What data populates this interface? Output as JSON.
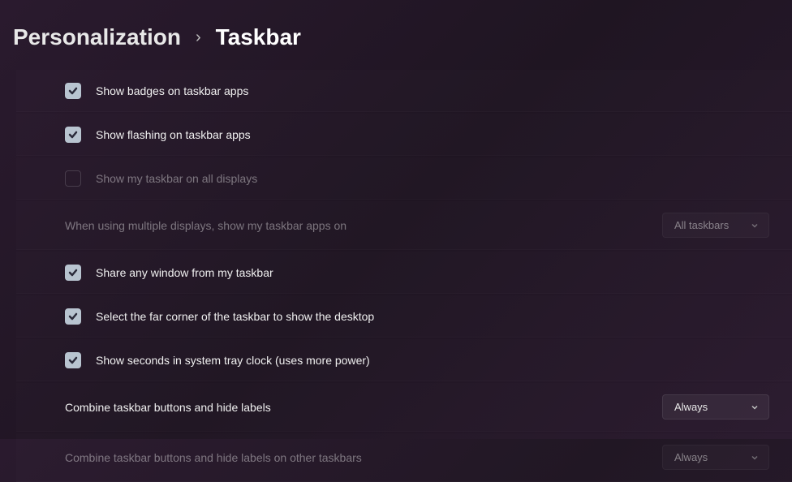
{
  "breadcrumb": {
    "parent": "Personalization",
    "current": "Taskbar"
  },
  "settings": {
    "show_badges": {
      "label": "Show badges on taskbar apps",
      "checked": true
    },
    "show_flashing": {
      "label": "Show flashing on taskbar apps",
      "checked": true
    },
    "show_all_displays": {
      "label": "Show my taskbar on all displays",
      "checked": false,
      "disabled": true
    },
    "multi_display_apps": {
      "label": "When using multiple displays, show my taskbar apps on",
      "value": "All taskbars",
      "disabled": true
    },
    "share_window": {
      "label": "Share any window from my taskbar",
      "checked": true
    },
    "far_corner": {
      "label": "Select the far corner of the taskbar to show the desktop",
      "checked": true
    },
    "show_seconds": {
      "label": "Show seconds in system tray clock (uses more power)",
      "checked": true
    },
    "combine_buttons": {
      "label": "Combine taskbar buttons and hide labels",
      "value": "Always"
    },
    "combine_buttons_other": {
      "label": "Combine taskbar buttons and hide labels on other taskbars",
      "value": "Always",
      "disabled": true
    }
  }
}
